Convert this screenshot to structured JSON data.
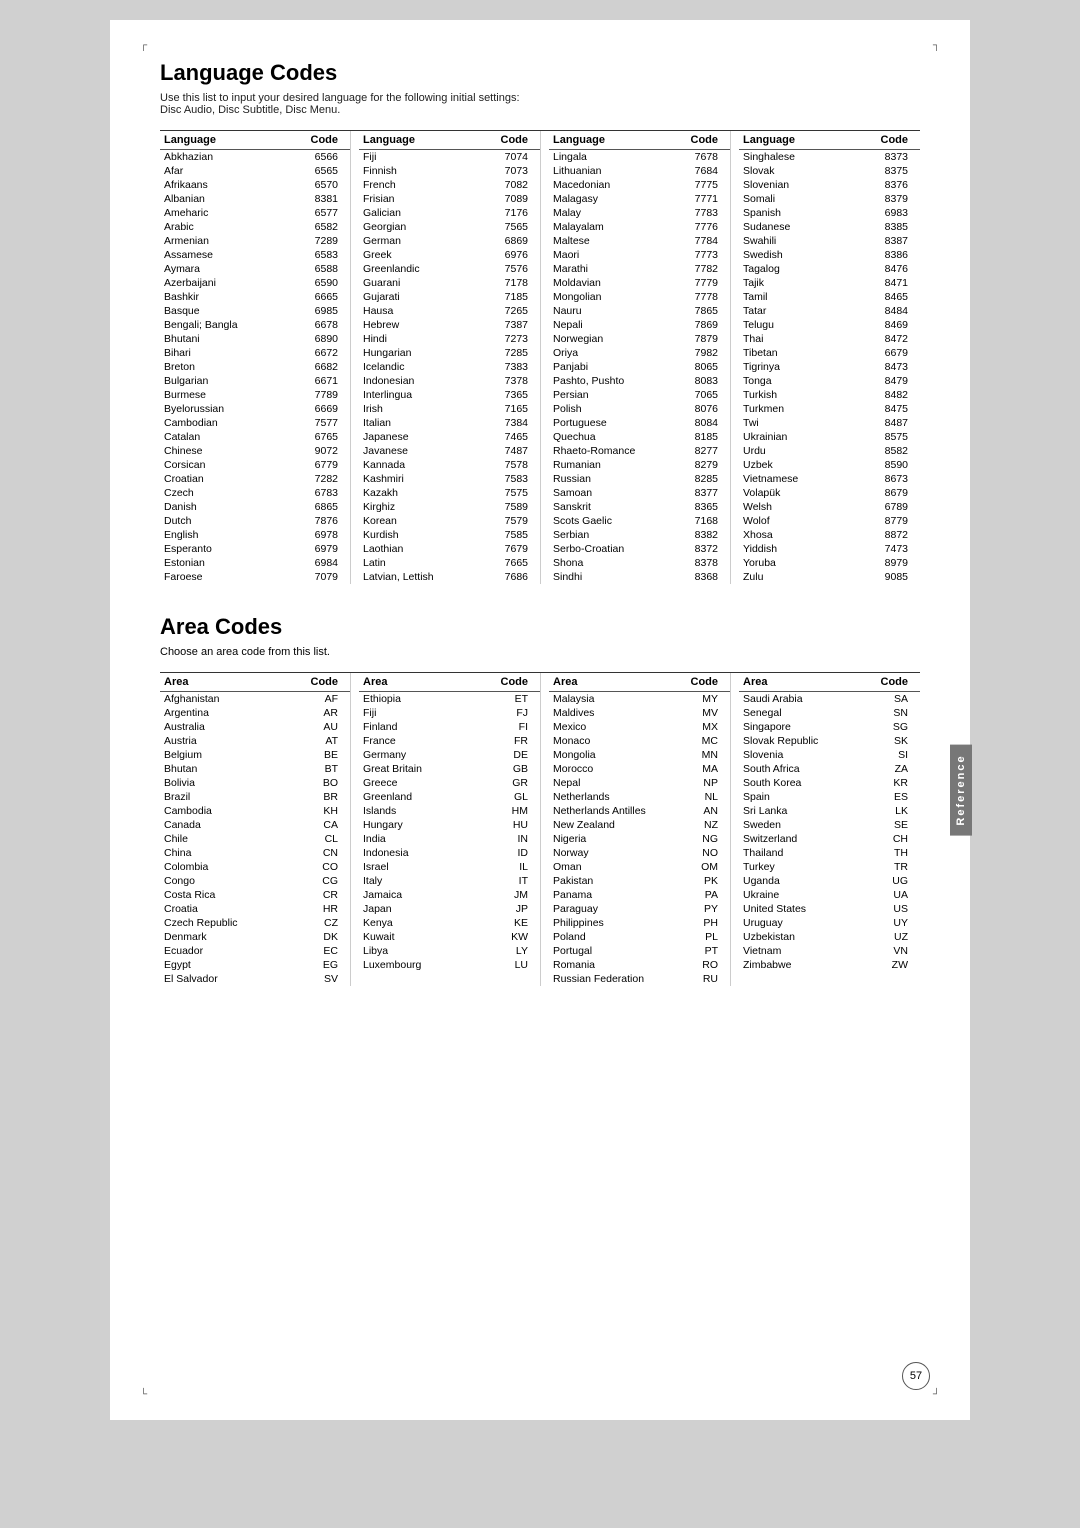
{
  "page": {
    "lang_title": "Language Codes",
    "lang_subtitle": "Use this list to input your desired language for the following initial settings:\nDisc Audio, Disc Subtitle, Disc Menu.",
    "area_title": "Area Codes",
    "area_subtitle": "Choose an area code from this list.",
    "page_number": "57",
    "reference_label": "Reference"
  },
  "lang_columns": [
    {
      "header": {
        "lang": "Language",
        "code": "Code"
      },
      "rows": [
        {
          "lang": "Abkhazian",
          "code": "6566"
        },
        {
          "lang": "Afar",
          "code": "6565"
        },
        {
          "lang": "Afrikaans",
          "code": "6570"
        },
        {
          "lang": "Albanian",
          "code": "8381"
        },
        {
          "lang": "Ameharic",
          "code": "6577"
        },
        {
          "lang": "Arabic",
          "code": "6582"
        },
        {
          "lang": "Armenian",
          "code": "7289"
        },
        {
          "lang": "Assamese",
          "code": "6583"
        },
        {
          "lang": "Aymara",
          "code": "6588"
        },
        {
          "lang": "Azerbaijani",
          "code": "6590"
        },
        {
          "lang": "Bashkir",
          "code": "6665"
        },
        {
          "lang": "Basque",
          "code": "6985"
        },
        {
          "lang": "Bengali; Bangla",
          "code": "6678"
        },
        {
          "lang": "Bhutani",
          "code": "6890"
        },
        {
          "lang": "Bihari",
          "code": "6672"
        },
        {
          "lang": "Breton",
          "code": "6682"
        },
        {
          "lang": "Bulgarian",
          "code": "6671"
        },
        {
          "lang": "Burmese",
          "code": "7789"
        },
        {
          "lang": "Byelorussian",
          "code": "6669"
        },
        {
          "lang": "Cambodian",
          "code": "7577"
        },
        {
          "lang": "Catalan",
          "code": "6765"
        },
        {
          "lang": "Chinese",
          "code": "9072"
        },
        {
          "lang": "Corsican",
          "code": "6779"
        },
        {
          "lang": "Croatian",
          "code": "7282"
        },
        {
          "lang": "Czech",
          "code": "6783"
        },
        {
          "lang": "Danish",
          "code": "6865"
        },
        {
          "lang": "Dutch",
          "code": "7876"
        },
        {
          "lang": "English",
          "code": "6978"
        },
        {
          "lang": "Esperanto",
          "code": "6979"
        },
        {
          "lang": "Estonian",
          "code": "6984"
        },
        {
          "lang": "Faroese",
          "code": "7079"
        }
      ]
    },
    {
      "header": {
        "lang": "Language",
        "code": "Code"
      },
      "rows": [
        {
          "lang": "Fiji",
          "code": "7074"
        },
        {
          "lang": "Finnish",
          "code": "7073"
        },
        {
          "lang": "French",
          "code": "7082"
        },
        {
          "lang": "Frisian",
          "code": "7089"
        },
        {
          "lang": "Galician",
          "code": "7176"
        },
        {
          "lang": "Georgian",
          "code": "7565"
        },
        {
          "lang": "German",
          "code": "6869"
        },
        {
          "lang": "Greek",
          "code": "6976"
        },
        {
          "lang": "Greenlandic",
          "code": "7576"
        },
        {
          "lang": "Guarani",
          "code": "7178"
        },
        {
          "lang": "Gujarati",
          "code": "7185"
        },
        {
          "lang": "Hausa",
          "code": "7265"
        },
        {
          "lang": "Hebrew",
          "code": "7387"
        },
        {
          "lang": "Hindi",
          "code": "7273"
        },
        {
          "lang": "Hungarian",
          "code": "7285"
        },
        {
          "lang": "Icelandic",
          "code": "7383"
        },
        {
          "lang": "Indonesian",
          "code": "7378"
        },
        {
          "lang": "Interlingua",
          "code": "7365"
        },
        {
          "lang": "Irish",
          "code": "7165"
        },
        {
          "lang": "Italian",
          "code": "7384"
        },
        {
          "lang": "Japanese",
          "code": "7465"
        },
        {
          "lang": "Javanese",
          "code": "7487"
        },
        {
          "lang": "Kannada",
          "code": "7578"
        },
        {
          "lang": "Kashmiri",
          "code": "7583"
        },
        {
          "lang": "Kazakh",
          "code": "7575"
        },
        {
          "lang": "Kirghiz",
          "code": "7589"
        },
        {
          "lang": "Korean",
          "code": "7579"
        },
        {
          "lang": "Kurdish",
          "code": "7585"
        },
        {
          "lang": "Laothian",
          "code": "7679"
        },
        {
          "lang": "Latin",
          "code": "7665"
        },
        {
          "lang": "Latvian, Lettish",
          "code": "7686"
        }
      ]
    },
    {
      "header": {
        "lang": "Language",
        "code": "Code"
      },
      "rows": [
        {
          "lang": "Lingala",
          "code": "7678"
        },
        {
          "lang": "Lithuanian",
          "code": "7684"
        },
        {
          "lang": "Macedonian",
          "code": "7775"
        },
        {
          "lang": "Malagasy",
          "code": "7771"
        },
        {
          "lang": "Malay",
          "code": "7783"
        },
        {
          "lang": "Malayalam",
          "code": "7776"
        },
        {
          "lang": "Maltese",
          "code": "7784"
        },
        {
          "lang": "Maori",
          "code": "7773"
        },
        {
          "lang": "Marathi",
          "code": "7782"
        },
        {
          "lang": "Moldavian",
          "code": "7779"
        },
        {
          "lang": "Mongolian",
          "code": "7778"
        },
        {
          "lang": "Nauru",
          "code": "7865"
        },
        {
          "lang": "Nepali",
          "code": "7869"
        },
        {
          "lang": "Norwegian",
          "code": "7879"
        },
        {
          "lang": "Oriya",
          "code": "7982"
        },
        {
          "lang": "Panjabi",
          "code": "8065"
        },
        {
          "lang": "Pashto, Pushto",
          "code": "8083"
        },
        {
          "lang": "Persian",
          "code": "7065"
        },
        {
          "lang": "Polish",
          "code": "8076"
        },
        {
          "lang": "Portuguese",
          "code": "8084"
        },
        {
          "lang": "Quechua",
          "code": "8185"
        },
        {
          "lang": "Rhaeto-Romance",
          "code": "8277"
        },
        {
          "lang": "Rumanian",
          "code": "8279"
        },
        {
          "lang": "Russian",
          "code": "8285"
        },
        {
          "lang": "Samoan",
          "code": "8377"
        },
        {
          "lang": "Sanskrit",
          "code": "8365"
        },
        {
          "lang": "Scots Gaelic",
          "code": "7168"
        },
        {
          "lang": "Serbian",
          "code": "8382"
        },
        {
          "lang": "Serbo-Croatian",
          "code": "8372"
        },
        {
          "lang": "Shona",
          "code": "8378"
        },
        {
          "lang": "Sindhi",
          "code": "8368"
        }
      ]
    },
    {
      "header": {
        "lang": "Language",
        "code": "Code"
      },
      "rows": [
        {
          "lang": "Singhalese",
          "code": "8373"
        },
        {
          "lang": "Slovak",
          "code": "8375"
        },
        {
          "lang": "Slovenian",
          "code": "8376"
        },
        {
          "lang": "Somali",
          "code": "8379"
        },
        {
          "lang": "Spanish",
          "code": "6983"
        },
        {
          "lang": "Sudanese",
          "code": "8385"
        },
        {
          "lang": "Swahili",
          "code": "8387"
        },
        {
          "lang": "Swedish",
          "code": "8386"
        },
        {
          "lang": "Tagalog",
          "code": "8476"
        },
        {
          "lang": "Tajik",
          "code": "8471"
        },
        {
          "lang": "Tamil",
          "code": "8465"
        },
        {
          "lang": "Tatar",
          "code": "8484"
        },
        {
          "lang": "Telugu",
          "code": "8469"
        },
        {
          "lang": "Thai",
          "code": "8472"
        },
        {
          "lang": "Tibetan",
          "code": "6679"
        },
        {
          "lang": "Tigrinya",
          "code": "8473"
        },
        {
          "lang": "Tonga",
          "code": "8479"
        },
        {
          "lang": "Turkish",
          "code": "8482"
        },
        {
          "lang": "Turkmen",
          "code": "8475"
        },
        {
          "lang": "Twi",
          "code": "8487"
        },
        {
          "lang": "Ukrainian",
          "code": "8575"
        },
        {
          "lang": "Urdu",
          "code": "8582"
        },
        {
          "lang": "Uzbek",
          "code": "8590"
        },
        {
          "lang": "Vietnamese",
          "code": "8673"
        },
        {
          "lang": "Volapük",
          "code": "8679"
        },
        {
          "lang": "Welsh",
          "code": "6789"
        },
        {
          "lang": "Wolof",
          "code": "8779"
        },
        {
          "lang": "Xhosa",
          "code": "8872"
        },
        {
          "lang": "Yiddish",
          "code": "7473"
        },
        {
          "lang": "Yoruba",
          "code": "8979"
        },
        {
          "lang": "Zulu",
          "code": "9085"
        }
      ]
    }
  ],
  "area_columns": [
    {
      "header": {
        "area": "Area",
        "code": "Code"
      },
      "rows": [
        {
          "area": "Afghanistan",
          "code": "AF"
        },
        {
          "area": "Argentina",
          "code": "AR"
        },
        {
          "area": "Australia",
          "code": "AU"
        },
        {
          "area": "Austria",
          "code": "AT"
        },
        {
          "area": "Belgium",
          "code": "BE"
        },
        {
          "area": "Bhutan",
          "code": "BT"
        },
        {
          "area": "Bolivia",
          "code": "BO"
        },
        {
          "area": "Brazil",
          "code": "BR"
        },
        {
          "area": "Cambodia",
          "code": "KH"
        },
        {
          "area": "Canada",
          "code": "CA"
        },
        {
          "area": "Chile",
          "code": "CL"
        },
        {
          "area": "China",
          "code": "CN"
        },
        {
          "area": "Colombia",
          "code": "CO"
        },
        {
          "area": "Congo",
          "code": "CG"
        },
        {
          "area": "Costa Rica",
          "code": "CR"
        },
        {
          "area": "Croatia",
          "code": "HR"
        },
        {
          "area": "Czech Republic",
          "code": "CZ"
        },
        {
          "area": "Denmark",
          "code": "DK"
        },
        {
          "area": "Ecuador",
          "code": "EC"
        },
        {
          "area": "Egypt",
          "code": "EG"
        },
        {
          "area": "El Salvador",
          "code": "SV"
        }
      ]
    },
    {
      "header": {
        "area": "Area",
        "code": "Code"
      },
      "rows": [
        {
          "area": "Ethiopia",
          "code": "ET"
        },
        {
          "area": "Fiji",
          "code": "FJ"
        },
        {
          "area": "Finland",
          "code": "FI"
        },
        {
          "area": "France",
          "code": "FR"
        },
        {
          "area": "Germany",
          "code": "DE"
        },
        {
          "area": "Great Britain",
          "code": "GB"
        },
        {
          "area": "Greece",
          "code": "GR"
        },
        {
          "area": "Greenland",
          "code": "GL"
        },
        {
          "area": "Islands",
          "code": "HM"
        },
        {
          "area": "Hungary",
          "code": "HU"
        },
        {
          "area": "India",
          "code": "IN"
        },
        {
          "area": "Indonesia",
          "code": "ID"
        },
        {
          "area": "Israel",
          "code": "IL"
        },
        {
          "area": "Italy",
          "code": "IT"
        },
        {
          "area": "Jamaica",
          "code": "JM"
        },
        {
          "area": "Japan",
          "code": "JP"
        },
        {
          "area": "Kenya",
          "code": "KE"
        },
        {
          "area": "Kuwait",
          "code": "KW"
        },
        {
          "area": "Libya",
          "code": "LY"
        },
        {
          "area": "Luxembourg",
          "code": "LU"
        }
      ]
    },
    {
      "header": {
        "area": "Area",
        "code": "Code"
      },
      "rows": [
        {
          "area": "Malaysia",
          "code": "MY"
        },
        {
          "area": "Maldives",
          "code": "MV"
        },
        {
          "area": "Mexico",
          "code": "MX"
        },
        {
          "area": "Monaco",
          "code": "MC"
        },
        {
          "area": "Mongolia",
          "code": "MN"
        },
        {
          "area": "Morocco",
          "code": "MA"
        },
        {
          "area": "Nepal",
          "code": "NP"
        },
        {
          "area": "Netherlands",
          "code": "NL"
        },
        {
          "area": "Netherlands Antilles",
          "code": "AN"
        },
        {
          "area": "New Zealand",
          "code": "NZ"
        },
        {
          "area": "Nigeria",
          "code": "NG"
        },
        {
          "area": "Norway",
          "code": "NO"
        },
        {
          "area": "Oman",
          "code": "OM"
        },
        {
          "area": "Pakistan",
          "code": "PK"
        },
        {
          "area": "Panama",
          "code": "PA"
        },
        {
          "area": "Paraguay",
          "code": "PY"
        },
        {
          "area": "Philippines",
          "code": "PH"
        },
        {
          "area": "Poland",
          "code": "PL"
        },
        {
          "area": "Portugal",
          "code": "PT"
        },
        {
          "area": "Romania",
          "code": "RO"
        },
        {
          "area": "Russian Federation",
          "code": "RU"
        }
      ]
    },
    {
      "header": {
        "area": "Area",
        "code": "Code"
      },
      "rows": [
        {
          "area": "Saudi Arabia",
          "code": "SA"
        },
        {
          "area": "Senegal",
          "code": "SN"
        },
        {
          "area": "Singapore",
          "code": "SG"
        },
        {
          "area": "Slovak Republic",
          "code": "SK"
        },
        {
          "area": "Slovenia",
          "code": "SI"
        },
        {
          "area": "South Africa",
          "code": "ZA"
        },
        {
          "area": "South Korea",
          "code": "KR"
        },
        {
          "area": "Spain",
          "code": "ES"
        },
        {
          "area": "Sri Lanka",
          "code": "LK"
        },
        {
          "area": "Sweden",
          "code": "SE"
        },
        {
          "area": "Switzerland",
          "code": "CH"
        },
        {
          "area": "Thailand",
          "code": "TH"
        },
        {
          "area": "Turkey",
          "code": "TR"
        },
        {
          "area": "Uganda",
          "code": "UG"
        },
        {
          "area": "Ukraine",
          "code": "UA"
        },
        {
          "area": "United States",
          "code": "US"
        },
        {
          "area": "Uruguay",
          "code": "UY"
        },
        {
          "area": "Uzbekistan",
          "code": "UZ"
        },
        {
          "area": "Vietnam",
          "code": "VN"
        },
        {
          "area": "Zimbabwe",
          "code": "ZW"
        }
      ]
    }
  ]
}
